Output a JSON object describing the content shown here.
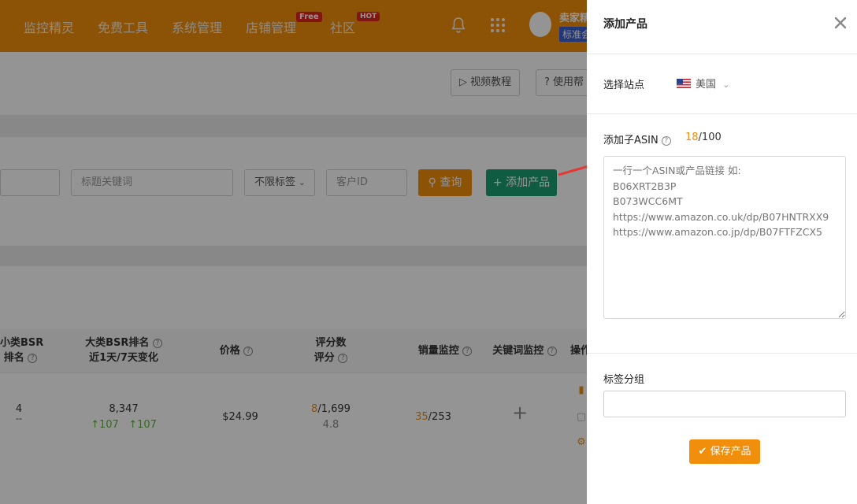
{
  "nav": {
    "items": [
      "监控精灵",
      "免费工具",
      "系统管理",
      "店铺管理",
      "社区"
    ],
    "badge_free": "Free",
    "badge_hot": "HOT",
    "brand_name": "卖家精",
    "brand_tag": "标准会",
    "icons": [
      "bell-icon",
      "apps-grid-icon"
    ]
  },
  "page": {
    "video_tutorial": "视频教程",
    "help": "使用帮",
    "filters": {
      "title_keyword_placeholder": "标题关键词",
      "tag_select": "不限标签",
      "customer_id_placeholder": "客户ID"
    },
    "query_button": "查询",
    "add_product_button": "添加产品",
    "table": {
      "headers": {
        "small_bsr_1": "小类BSR",
        "small_bsr_2": "排名",
        "big_bsr_1": "大类BSR排名",
        "big_bsr_2": "近1天/7天变化",
        "price": "价格",
        "reviews_1": "评分数",
        "reviews_2": "评分",
        "sales_monitor": "销量监控",
        "keyword_monitor": "关键词监控",
        "actions": "操作"
      },
      "row": {
        "small_bsr": "4",
        "small_bsr_sub": "--",
        "big_bsr": "8,347",
        "big_bsr_change_1d": "107",
        "big_bsr_change_7d": "107",
        "price": "$24.99",
        "review_new": "8",
        "review_total": "/1,699",
        "rating": "4.8",
        "sales_new": "35",
        "sales_total": "/253",
        "keyword_add": "+"
      }
    }
  },
  "drawer": {
    "title": "添加产品",
    "site_label": "选择站点",
    "site_value": "美国",
    "asin_label": "添加子ASIN",
    "asin_count": "18",
    "asin_limit": "/100",
    "asin_placeholder": "一行一个ASIN或产品链接 如:\nB06XRT2B3P\nB073WCC6MT\nhttps://www.amazon.co.uk/dp/B07HNTRXX9\nhttps://www.amazon.co.jp/dp/B07FTFZCX5",
    "tag_group_label": "标签分组",
    "tag_group_value": "",
    "save_button": "保存产品"
  },
  "colors": {
    "brand_orange": "#f18e0c",
    "add_green": "#1a9f73",
    "annotation_red": "#e53935"
  }
}
